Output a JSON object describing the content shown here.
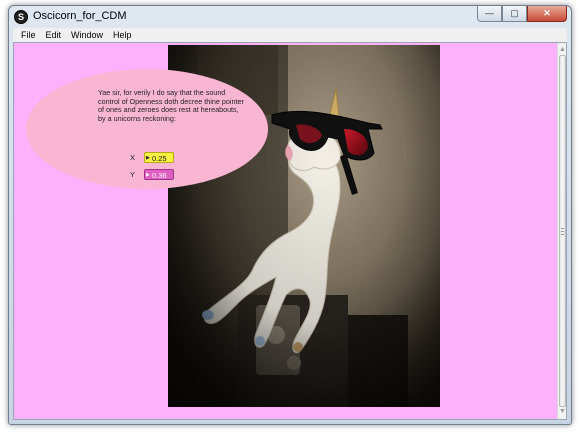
{
  "window": {
    "title": "Oscicorn_for_CDM",
    "icon_glyph": "S",
    "controls": {
      "minimize": "—",
      "maximize": "▢",
      "close": "✕"
    }
  },
  "menubar": {
    "items": [
      "File",
      "Edit",
      "Window",
      "Help"
    ]
  },
  "canvas": {
    "background_color": "#fdb0fb",
    "speech_bubble_color": "#f9b6d3",
    "message": "Yae sir, for verily I do say that the sound control of Openness doth decree thine pointer of ones and zeroes does rest at hereabouts, by a unicorns reckoning:",
    "x": {
      "label": "X",
      "value": "0.25",
      "color": "#f7f142"
    },
    "y": {
      "label": "Y",
      "value": "0.36",
      "color": "#e05fc3"
    }
  },
  "photo": {
    "subject": "unicorn-figurine-with-3d-glasses"
  },
  "scrollbar": {
    "up_icon": "scroll-up-arrow-icon",
    "down_icon": "scroll-down-arrow-icon"
  }
}
